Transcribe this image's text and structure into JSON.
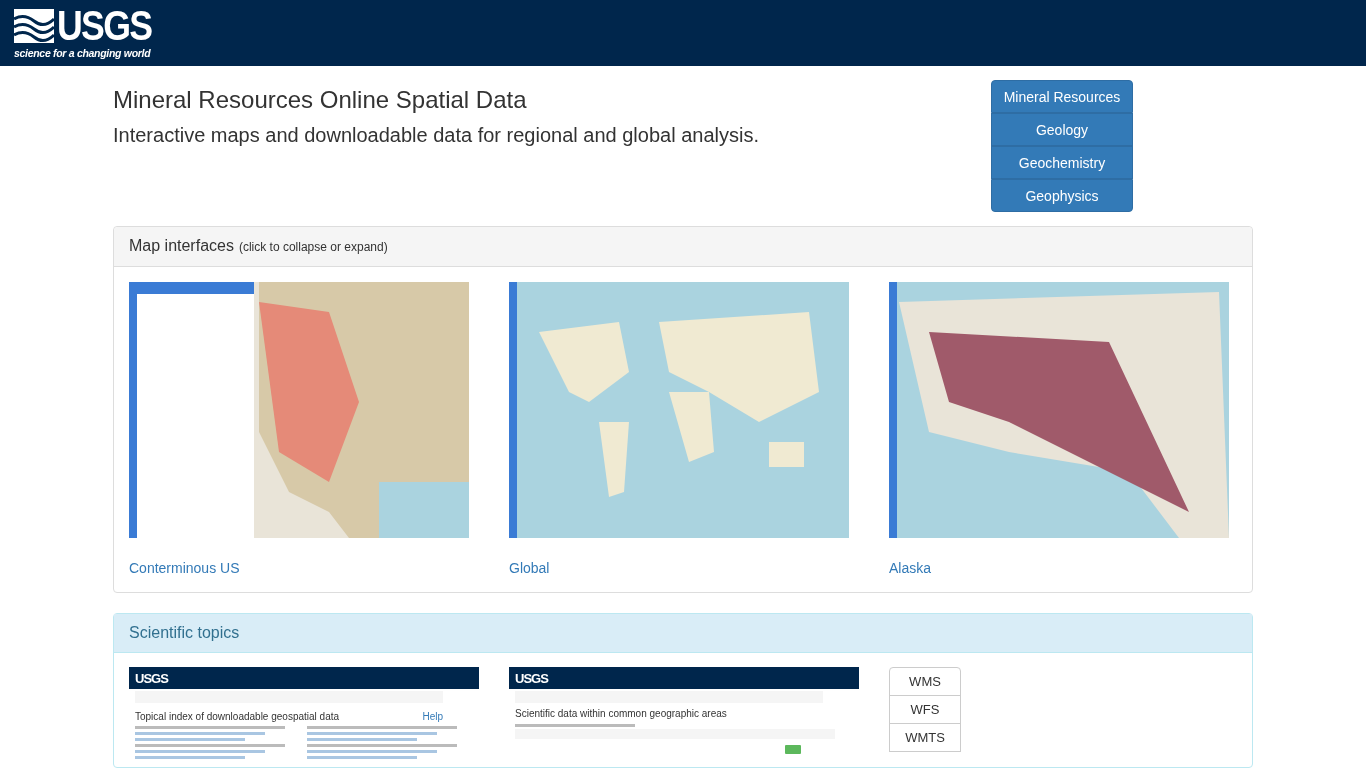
{
  "header": {
    "logo": "USGS",
    "tagline": "science for a changing world"
  },
  "title": "Mineral Resources Online Spatial Data",
  "subtitle": "Interactive maps and downloadable data for regional and global analysis.",
  "nav": [
    {
      "label": "Mineral Resources"
    },
    {
      "label": "Geology"
    },
    {
      "label": "Geochemistry"
    },
    {
      "label": "Geophysics"
    }
  ],
  "map_panel": {
    "title": "Map interfaces",
    "hint": "(click to collapse or expand)",
    "maps": [
      {
        "kind": "us",
        "label": "Conterminous US"
      },
      {
        "kind": "world",
        "label": "Global"
      },
      {
        "kind": "alaska",
        "label": "Alaska"
      }
    ]
  },
  "topics_panel": {
    "title": "Scientific topics",
    "previews": [
      {
        "kind": "index",
        "logo": "USGS",
        "title": "Topical index of downloadable geospatial data",
        "help": "Help"
      },
      {
        "kind": "areas",
        "logo": "USGS",
        "title": "Scientific data within common geographic areas"
      }
    ],
    "services": [
      "WMS",
      "WFS",
      "WMTS"
    ]
  }
}
